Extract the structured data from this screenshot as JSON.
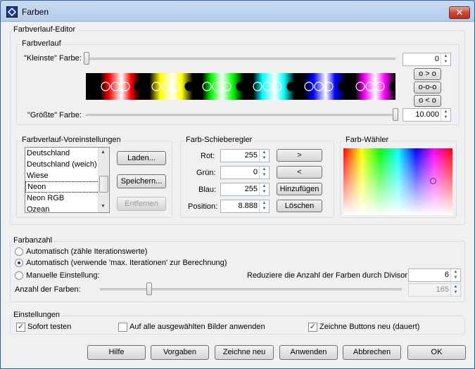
{
  "window": {
    "title": "Farben"
  },
  "editor": {
    "title": "Farbverlauf-Editor",
    "gradient_title": "Farbverlauf",
    "smallest_label": "\"Kleinste\" Farbe:",
    "smallest_value": "0",
    "largest_label": "\"Größte\" Farbe:",
    "largest_value": "10.000",
    "shift_buttons": [
      "o > o",
      "o-o-o",
      "o < o"
    ]
  },
  "presets": {
    "title": "Farbverlauf-Voreinstellungen",
    "items": [
      "Deutschland",
      "Deutschland (weich)",
      "Wiese",
      "Neon",
      "Neon RGB",
      "Ozean"
    ],
    "selected": "Neon",
    "load_label": "Laden...",
    "save_label": "Speichern...",
    "remove_label": "Entfernen"
  },
  "sliders": {
    "title": "Farb-Schieberegler",
    "red_label": "Rot:",
    "red_value": "255",
    "green_label": "Grün:",
    "green_value": "0",
    "blue_label": "Blau:",
    "blue_value": "255",
    "position_label": "Position:",
    "position_value": "8.888",
    "next_label": ">",
    "prev_label": "<",
    "add_label": "Hinzufügen",
    "delete_label": "Löschen"
  },
  "picker": {
    "title": "Farb-Wähler"
  },
  "count": {
    "title": "Farbanzahl",
    "auto1_label": "Automatisch (zähle Iterationswerte)",
    "auto2_label": "Automatisch (verwende 'max. Iterationen' zur Berechnung)",
    "manual_label": "Manuelle Einstellung:",
    "selected_mode": "auto2",
    "divisor_label": "Reduziere die Anzahl der Farben durch Divisor:",
    "divisor_value": "6",
    "count_label": "Anzahl der Farben:",
    "count_value": "165"
  },
  "settings": {
    "title": "Einstellungen",
    "test_label": "Sofort testen",
    "test_checked": true,
    "apply_all_label": "Auf alle ausgewählten Bilder anwenden",
    "apply_all_checked": false,
    "redraw_buttons_label": "Zeichne Buttons neu (dauert)",
    "redraw_buttons_checked": true
  },
  "footer": {
    "help": "Hilfe",
    "defaults": "Vorgaben",
    "redraw": "Zeichne neu",
    "apply": "Anwenden",
    "cancel": "Abbrechen",
    "ok": "OK"
  },
  "colors": {
    "title_bar": "#b9cfea",
    "dialog": "#f0f0f0",
    "icon": "#1c3b8a"
  },
  "icons": {
    "app": "app-icon",
    "close": "close-icon"
  }
}
